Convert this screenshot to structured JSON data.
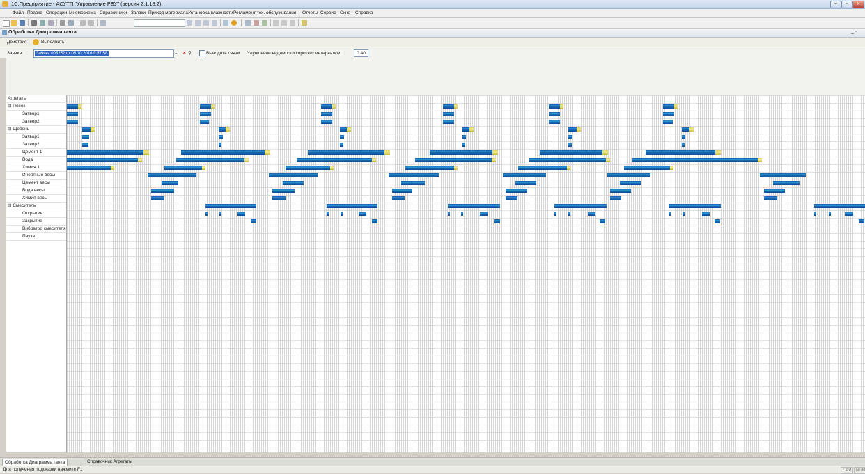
{
  "window": {
    "title": "1С:Предприятие - АСУТП \"Управление РБУ\" (версия 2.1.13.2)."
  },
  "menu": [
    "Файл",
    "Правка",
    "Операции",
    "Мнемосхема",
    "Справочники",
    "Заявки",
    "Приход материала",
    "Установка влажности",
    "Регламент тех. обслуживания",
    "Отчеты",
    "Сервис",
    "Окна",
    "Справка"
  ],
  "form": {
    "title": "Обработка Диаграмма ганта",
    "actions_label": "Действия",
    "execute_label": "Выполнить",
    "zayavka_label": "Заявка:",
    "zayavka_value": "Заявка 005252 от 05.10.2016 9:57:58",
    "show_links_label": "Выводить связи",
    "visibility_label": "Улучшение видимости коротких интервалов:",
    "visibility_value": "0.40"
  },
  "gantt": {
    "header_label": "Агрегаты",
    "rows": [
      {
        "label": "Песок",
        "group": true
      },
      {
        "label": "Затвор1",
        "group": false
      },
      {
        "label": "Затвор2",
        "group": false
      },
      {
        "label": "Щебень",
        "group": true
      },
      {
        "label": "Затвор1",
        "group": false
      },
      {
        "label": "Затвор2",
        "group": false
      },
      {
        "label": "Цемент 1",
        "group": false
      },
      {
        "label": "Вода",
        "group": false
      },
      {
        "label": "Химия 1",
        "group": false
      },
      {
        "label": "Инертные весы",
        "group": false
      },
      {
        "label": "Цемент весы",
        "group": false
      },
      {
        "label": "Вода весы",
        "group": false
      },
      {
        "label": "Химия весы",
        "group": false
      },
      {
        "label": "Смеситель",
        "group": true
      },
      {
        "label": "Открытие",
        "group": false
      },
      {
        "label": "Закрытие",
        "group": false
      },
      {
        "label": "Вибратор смесителя",
        "group": false
      },
      {
        "label": "Пауза",
        "group": false
      }
    ],
    "expand_glyph": "⊟"
  },
  "tabs": [
    "Обработка Диаграмма ганта",
    "Справочник Агрегаты"
  ],
  "status": {
    "hint": "Для получения подсказки нажмите F1",
    "indicators": [
      "CAP",
      "NUM"
    ]
  }
}
